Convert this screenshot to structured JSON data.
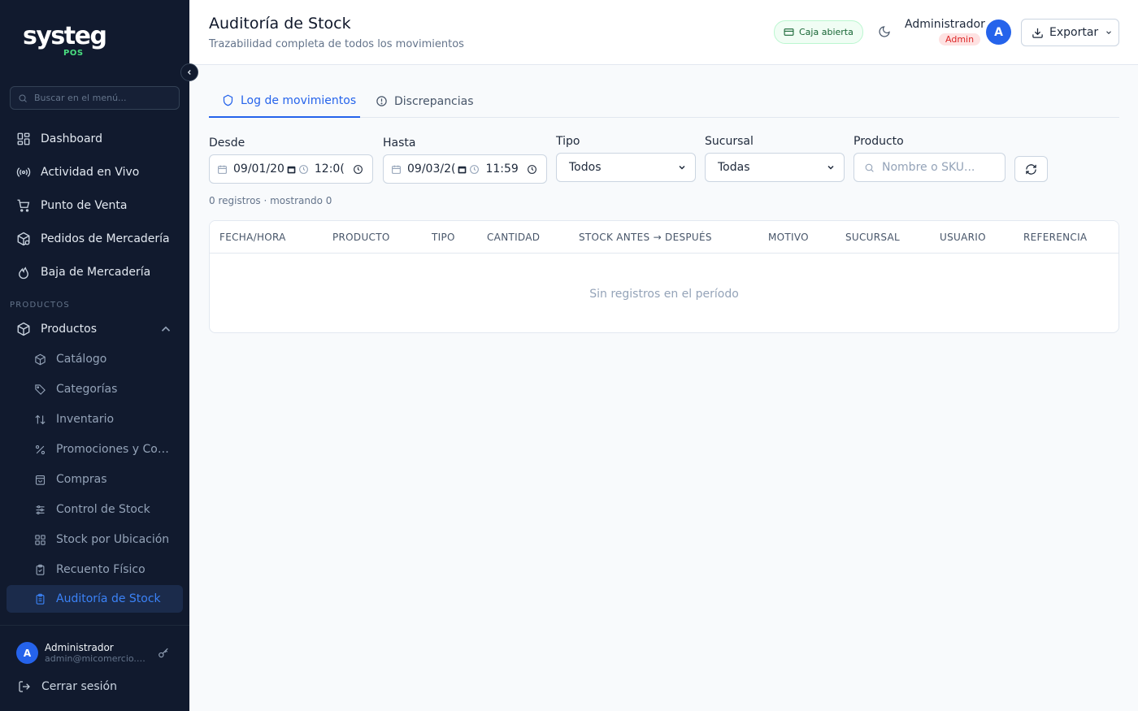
{
  "brand": {
    "name": "systeg",
    "sub": "POS"
  },
  "sidebar": {
    "search_placeholder": "Buscar en el menú...",
    "top_items": [
      {
        "label": "Dashboard",
        "icon": "grid-icon"
      },
      {
        "label": "Actividad en Vivo",
        "icon": "broadcast-icon"
      },
      {
        "label": "Punto de Venta",
        "icon": "cart-icon"
      },
      {
        "label": "Pedidos de Mercadería",
        "icon": "package-icon"
      },
      {
        "label": "Baja de Mercadería",
        "icon": "flame-icon"
      }
    ],
    "section_label": "PRODUCTOS",
    "group": {
      "label": "Productos",
      "icon": "box-icon"
    },
    "sub_items": [
      {
        "label": "Catálogo",
        "icon": "cube-icon"
      },
      {
        "label": "Categorías",
        "icon": "tag-icon"
      },
      {
        "label": "Inventario",
        "icon": "arrows-updown-icon"
      },
      {
        "label": "Promociones y Combos",
        "icon": "percent-icon"
      },
      {
        "label": "Compras",
        "icon": "shopping-bag-icon"
      },
      {
        "label": "Control de Stock",
        "icon": "sliders-icon"
      },
      {
        "label": "Stock por Ubicación",
        "icon": "grid-small-icon"
      },
      {
        "label": "Recuento Físico",
        "icon": "clipboard-check-icon"
      },
      {
        "label": "Auditoría de Stock",
        "icon": "clipboard-list-icon",
        "active": true
      }
    ],
    "footer": {
      "avatar": "A",
      "user_name": "Administrador",
      "user_email": "admin@micomercio.com",
      "logout": "Cerrar sesión"
    }
  },
  "header": {
    "title": "Auditoría de Stock",
    "subtitle": "Trazabilidad completa de todos los movimientos",
    "caja": "Caja abierta",
    "admin_name": "Administrador",
    "admin_role": "Admin",
    "avatar": "A",
    "export_label": "Exportar"
  },
  "tabs": [
    {
      "label": "Log de movimientos",
      "active": true
    },
    {
      "label": "Discrepancias",
      "active": false
    }
  ],
  "filters": {
    "desde": {
      "label": "Desde",
      "date": "09/01/20",
      "time": "12:0("
    },
    "hasta": {
      "label": "Hasta",
      "date": "09/03/2(",
      "time": "11:59"
    },
    "tipo": {
      "label": "Tipo",
      "value": "Todos"
    },
    "sucursal": {
      "label": "Sucursal",
      "value": "Todas"
    },
    "producto": {
      "label": "Producto",
      "placeholder": "Nombre o SKU..."
    }
  },
  "count_text": "0 registros · mostrando 0",
  "table": {
    "columns": [
      "FECHA/HORA",
      "PRODUCTO",
      "TIPO",
      "CANTIDAD",
      "STOCK ANTES → DESPUÉS",
      "MOTIVO",
      "SUCURSAL",
      "USUARIO",
      "REFERENCIA"
    ],
    "empty": "Sin registros en el período"
  },
  "colors": {
    "sidebar_bg": "#111a2e",
    "accent": "#2563eb",
    "brand_green": "#4ade80",
    "admin_badge": "#dc2626"
  }
}
